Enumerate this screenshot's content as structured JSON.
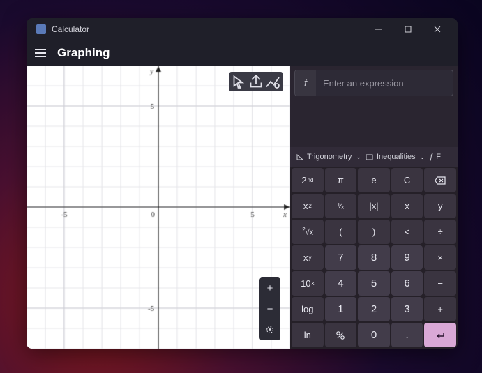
{
  "app": {
    "title": "Calculator"
  },
  "header": {
    "mode": "Graphing"
  },
  "graph": {
    "toolbar": {
      "trace": "trace-icon",
      "share": "share-icon",
      "options": "options-icon"
    },
    "zoom": {
      "in": "+",
      "out": "−",
      "reset": "⦿"
    },
    "axes": {
      "x_label": "x",
      "y_label": "y",
      "ticks": [
        "-5",
        "5"
      ]
    }
  },
  "expression": {
    "f_label": "f",
    "placeholder": "Enter an expression"
  },
  "categories": {
    "trig": "Trigonometry",
    "ineq": "Inequalities",
    "func": "F"
  },
  "keys": {
    "r0": [
      "2ⁿᵈ",
      "π",
      "e",
      "C",
      "⌫"
    ],
    "r1": [
      "x²",
      "¹⁄ₓ",
      "|x|",
      "x",
      "y"
    ],
    "r2": [
      "²√x",
      "(",
      ")",
      "<",
      "÷"
    ],
    "r3": [
      "xʸ",
      "7",
      "8",
      "9",
      "×"
    ],
    "r4": [
      "10ˣ",
      "4",
      "5",
      "6",
      "−"
    ],
    "r5": [
      "log",
      "1",
      "2",
      "3",
      "+"
    ],
    "r6": [
      "ln",
      "⁺⁄₋",
      "0",
      ".",
      "↵"
    ]
  },
  "chart_data": {
    "type": "line",
    "title": "",
    "xlabel": "x",
    "ylabel": "y",
    "xlim": [
      -7,
      7
    ],
    "ylim": [
      -7,
      7
    ],
    "series": []
  }
}
